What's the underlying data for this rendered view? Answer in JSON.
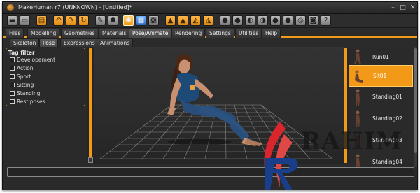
{
  "window": {
    "title": "MakeHuman r7 (UNKNOWN) - [Untitled]*"
  },
  "toolbar": {
    "icons": [
      "file-icon",
      "save-icon",
      "export-icon",
      "undo-icon",
      "redo-icon",
      "reset-icon",
      "wireframe-icon",
      "pose-icon",
      "grid-icon",
      "checker-icon",
      "front-view-icon",
      "back-view-icon",
      "left-view-icon",
      "right-view-icon",
      "top-view-icon",
      "bottom-view-icon",
      "reset-camera-icon",
      "screenshot-icon",
      "help-icon"
    ]
  },
  "main_tabs": [
    {
      "label": "Files"
    },
    {
      "label": "Modelling"
    },
    {
      "label": "Geometries"
    },
    {
      "label": "Materials"
    },
    {
      "label": "Pose/Animate",
      "active": true
    },
    {
      "label": "Rendering"
    },
    {
      "label": "Settings"
    },
    {
      "label": "Utilities"
    },
    {
      "label": "Help"
    }
  ],
  "sub_tabs": [
    {
      "label": "Skeleton"
    },
    {
      "label": "Pose",
      "active": true
    },
    {
      "label": "Expressions"
    },
    {
      "label": "Animations"
    }
  ],
  "tag_filter": {
    "title": "Tag filter",
    "items": [
      {
        "label": "Developement",
        "checked": false
      },
      {
        "label": "Action",
        "checked": false
      },
      {
        "label": "Sport",
        "checked": false
      },
      {
        "label": "Sitting",
        "checked": false
      },
      {
        "label": "Standing",
        "checked": false
      },
      {
        "label": "Rest poses",
        "checked": false
      }
    ]
  },
  "pose_list": [
    {
      "label": "Run01",
      "selected": false
    },
    {
      "label": "Sit01",
      "selected": true
    },
    {
      "label": "Standing01",
      "selected": false
    },
    {
      "label": "Standing02",
      "selected": false
    },
    {
      "label": "Standing03",
      "selected": false
    },
    {
      "label": "Standing04",
      "selected": false
    }
  ],
  "watermark": {
    "text": "RAHIM"
  },
  "colors": {
    "accent": "#f29a18",
    "background": "#2a2a2a",
    "text": "#e4e4e4"
  }
}
